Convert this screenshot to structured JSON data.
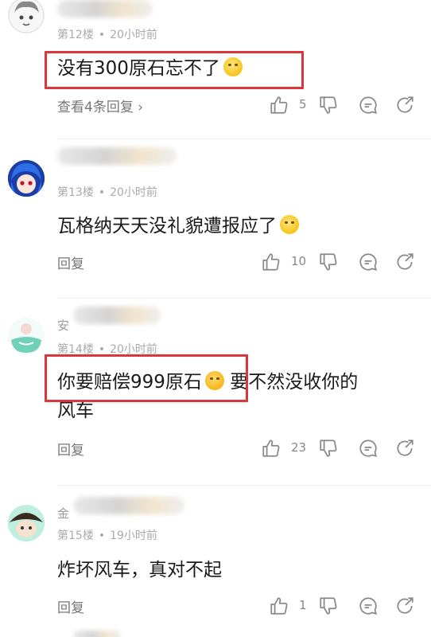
{
  "comments": [
    {
      "floor": "第12楼",
      "time": "20小时前",
      "body": "没有300原石忘不了",
      "view_replies": "查看4条回复",
      "likes": "5"
    },
    {
      "floor": "第13楼",
      "time": "20小时前",
      "body": "瓦格纳天天没礼貌遭报应了",
      "reply_label": "回复",
      "likes": "10"
    },
    {
      "name_partial": "安",
      "floor": "第14楼",
      "time": "20小时前",
      "body_line1": "你要赔偿999原石",
      "body_line1b": "要不然没收你的",
      "body_line2": "风车",
      "reply_label": "回复",
      "likes": "23"
    },
    {
      "name_partial": "金",
      "floor": "第15楼",
      "time": "19小时前",
      "body": "炸坏风车，真对不起",
      "reply_label": "回复",
      "likes": "1"
    }
  ],
  "colors": {
    "highlight": "#d9363e",
    "meta": "#aaaaaa",
    "action": "#888888"
  },
  "icons": [
    "thumb-up-icon",
    "thumb-down-icon",
    "comment-icon",
    "share-icon",
    "chevron-right-icon"
  ]
}
